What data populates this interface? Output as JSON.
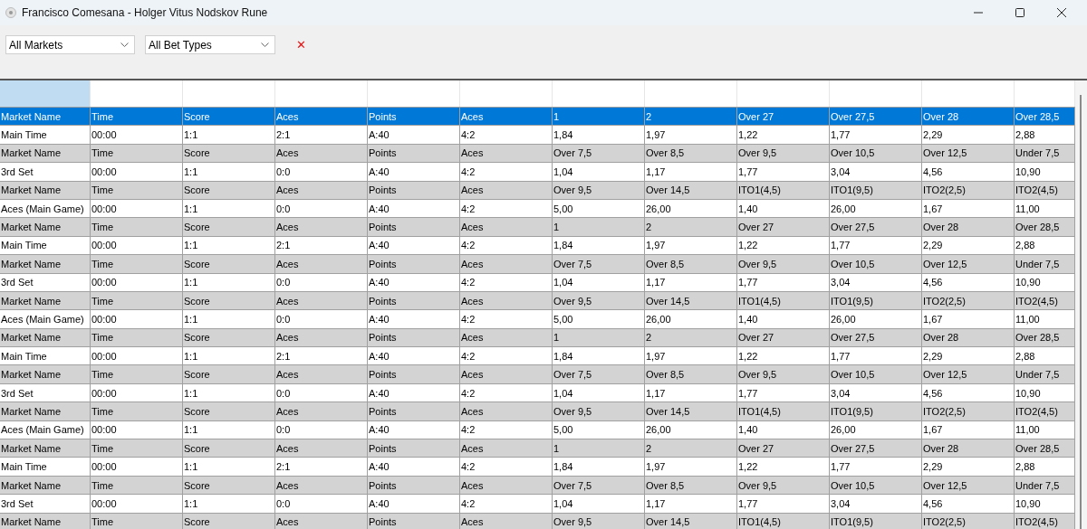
{
  "window": {
    "title": "Francisco Comesana - Holger Vitus Nodskov Rune"
  },
  "filters": {
    "market": {
      "value": "All Markets"
    },
    "bet_type": {
      "value": "All Bet Types"
    },
    "clear": {
      "label": "✕"
    }
  },
  "table": {
    "rows": [
      {
        "kind": "header",
        "selected": true,
        "cells": [
          "Market Name",
          "Time",
          "Score",
          "Aces",
          "Points",
          "Aces",
          "1",
          "2",
          "Over 27",
          "Over 27,5",
          "Over 28",
          "Over 28,5"
        ]
      },
      {
        "kind": "data",
        "selected": false,
        "cells": [
          "Main Time",
          "00:00",
          "1:1",
          "2:1",
          "A:40",
          "4:2",
          "1,84",
          "1,97",
          "1,22",
          "1,77",
          "2,29",
          "2,88"
        ]
      },
      {
        "kind": "header",
        "selected": false,
        "cells": [
          "Market Name",
          "Time",
          "Score",
          "Aces",
          "Points",
          "Aces",
          "Over 7,5",
          "Over 8,5",
          "Over 9,5",
          "Over 10,5",
          "Over 12,5",
          "Under 7,5"
        ]
      },
      {
        "kind": "data",
        "selected": false,
        "cells": [
          "3rd Set",
          "00:00",
          "1:1",
          "0:0",
          "A:40",
          "4:2",
          "1,04",
          "1,17",
          "1,77",
          "3,04",
          "4,56",
          "10,90"
        ]
      },
      {
        "kind": "header",
        "selected": false,
        "cells": [
          "Market Name",
          "Time",
          "Score",
          "Aces",
          "Points",
          "Aces",
          "Over 9,5",
          "Over 14,5",
          "ITO1(4,5)",
          "ITO1(9,5)",
          "ITO2(2,5)",
          "ITO2(4,5)"
        ]
      },
      {
        "kind": "data",
        "selected": false,
        "cells": [
          "Aces (Main Game)",
          "00:00",
          "1:1",
          "0:0",
          "A:40",
          "4:2",
          "5,00",
          "26,00",
          "1,40",
          "26,00",
          "1,67",
          "11,00"
        ]
      },
      {
        "kind": "header",
        "selected": false,
        "cells": [
          "Market Name",
          "Time",
          "Score",
          "Aces",
          "Points",
          "Aces",
          "1",
          "2",
          "Over 27",
          "Over 27,5",
          "Over 28",
          "Over 28,5"
        ]
      },
      {
        "kind": "data",
        "selected": false,
        "cells": [
          "Main Time",
          "00:00",
          "1:1",
          "2:1",
          "A:40",
          "4:2",
          "1,84",
          "1,97",
          "1,22",
          "1,77",
          "2,29",
          "2,88"
        ]
      },
      {
        "kind": "header",
        "selected": false,
        "cells": [
          "Market Name",
          "Time",
          "Score",
          "Aces",
          "Points",
          "Aces",
          "Over 7,5",
          "Over 8,5",
          "Over 9,5",
          "Over 10,5",
          "Over 12,5",
          "Under 7,5"
        ]
      },
      {
        "kind": "data",
        "selected": false,
        "cells": [
          "3rd Set",
          "00:00",
          "1:1",
          "0:0",
          "A:40",
          "4:2",
          "1,04",
          "1,17",
          "1,77",
          "3,04",
          "4,56",
          "10,90"
        ]
      },
      {
        "kind": "header",
        "selected": false,
        "cells": [
          "Market Name",
          "Time",
          "Score",
          "Aces",
          "Points",
          "Aces",
          "Over 9,5",
          "Over 14,5",
          "ITO1(4,5)",
          "ITO1(9,5)",
          "ITO2(2,5)",
          "ITO2(4,5)"
        ]
      },
      {
        "kind": "data",
        "selected": false,
        "cells": [
          "Aces (Main Game)",
          "00:00",
          "1:1",
          "0:0",
          "A:40",
          "4:2",
          "5,00",
          "26,00",
          "1,40",
          "26,00",
          "1,67",
          "11,00"
        ]
      },
      {
        "kind": "header",
        "selected": false,
        "cells": [
          "Market Name",
          "Time",
          "Score",
          "Aces",
          "Points",
          "Aces",
          "1",
          "2",
          "Over 27",
          "Over 27,5",
          "Over 28",
          "Over 28,5"
        ]
      },
      {
        "kind": "data",
        "selected": false,
        "cells": [
          "Main Time",
          "00:00",
          "1:1",
          "2:1",
          "A:40",
          "4:2",
          "1,84",
          "1,97",
          "1,22",
          "1,77",
          "2,29",
          "2,88"
        ]
      },
      {
        "kind": "header",
        "selected": false,
        "cells": [
          "Market Name",
          "Time",
          "Score",
          "Aces",
          "Points",
          "Aces",
          "Over 7,5",
          "Over 8,5",
          "Over 9,5",
          "Over 10,5",
          "Over 12,5",
          "Under 7,5"
        ]
      },
      {
        "kind": "data",
        "selected": false,
        "cells": [
          "3rd Set",
          "00:00",
          "1:1",
          "0:0",
          "A:40",
          "4:2",
          "1,04",
          "1,17",
          "1,77",
          "3,04",
          "4,56",
          "10,90"
        ]
      },
      {
        "kind": "header",
        "selected": false,
        "cells": [
          "Market Name",
          "Time",
          "Score",
          "Aces",
          "Points",
          "Aces",
          "Over 9,5",
          "Over 14,5",
          "ITO1(4,5)",
          "ITO1(9,5)",
          "ITO2(2,5)",
          "ITO2(4,5)"
        ]
      },
      {
        "kind": "data",
        "selected": false,
        "cells": [
          "Aces (Main Game)",
          "00:00",
          "1:1",
          "0:0",
          "A:40",
          "4:2",
          "5,00",
          "26,00",
          "1,40",
          "26,00",
          "1,67",
          "11,00"
        ]
      },
      {
        "kind": "header",
        "selected": false,
        "cells": [
          "Market Name",
          "Time",
          "Score",
          "Aces",
          "Points",
          "Aces",
          "1",
          "2",
          "Over 27",
          "Over 27,5",
          "Over 28",
          "Over 28,5"
        ]
      },
      {
        "kind": "data",
        "selected": false,
        "cells": [
          "Main Time",
          "00:00",
          "1:1",
          "2:1",
          "A:40",
          "4:2",
          "1,84",
          "1,97",
          "1,22",
          "1,77",
          "2,29",
          "2,88"
        ]
      },
      {
        "kind": "header",
        "selected": false,
        "cells": [
          "Market Name",
          "Time",
          "Score",
          "Aces",
          "Points",
          "Aces",
          "Over 7,5",
          "Over 8,5",
          "Over 9,5",
          "Over 10,5",
          "Over 12,5",
          "Under 7,5"
        ]
      },
      {
        "kind": "data",
        "selected": false,
        "cells": [
          "3rd Set",
          "00:00",
          "1:1",
          "0:0",
          "A:40",
          "4:2",
          "1,04",
          "1,17",
          "1,77",
          "3,04",
          "4,56",
          "10,90"
        ]
      },
      {
        "kind": "header",
        "selected": false,
        "cells": [
          "Market Name",
          "Time",
          "Score",
          "Aces",
          "Points",
          "Aces",
          "Over 9,5",
          "Over 14,5",
          "ITO1(4,5)",
          "ITO1(9,5)",
          "ITO2(2,5)",
          "ITO2(4,5)"
        ]
      }
    ]
  }
}
